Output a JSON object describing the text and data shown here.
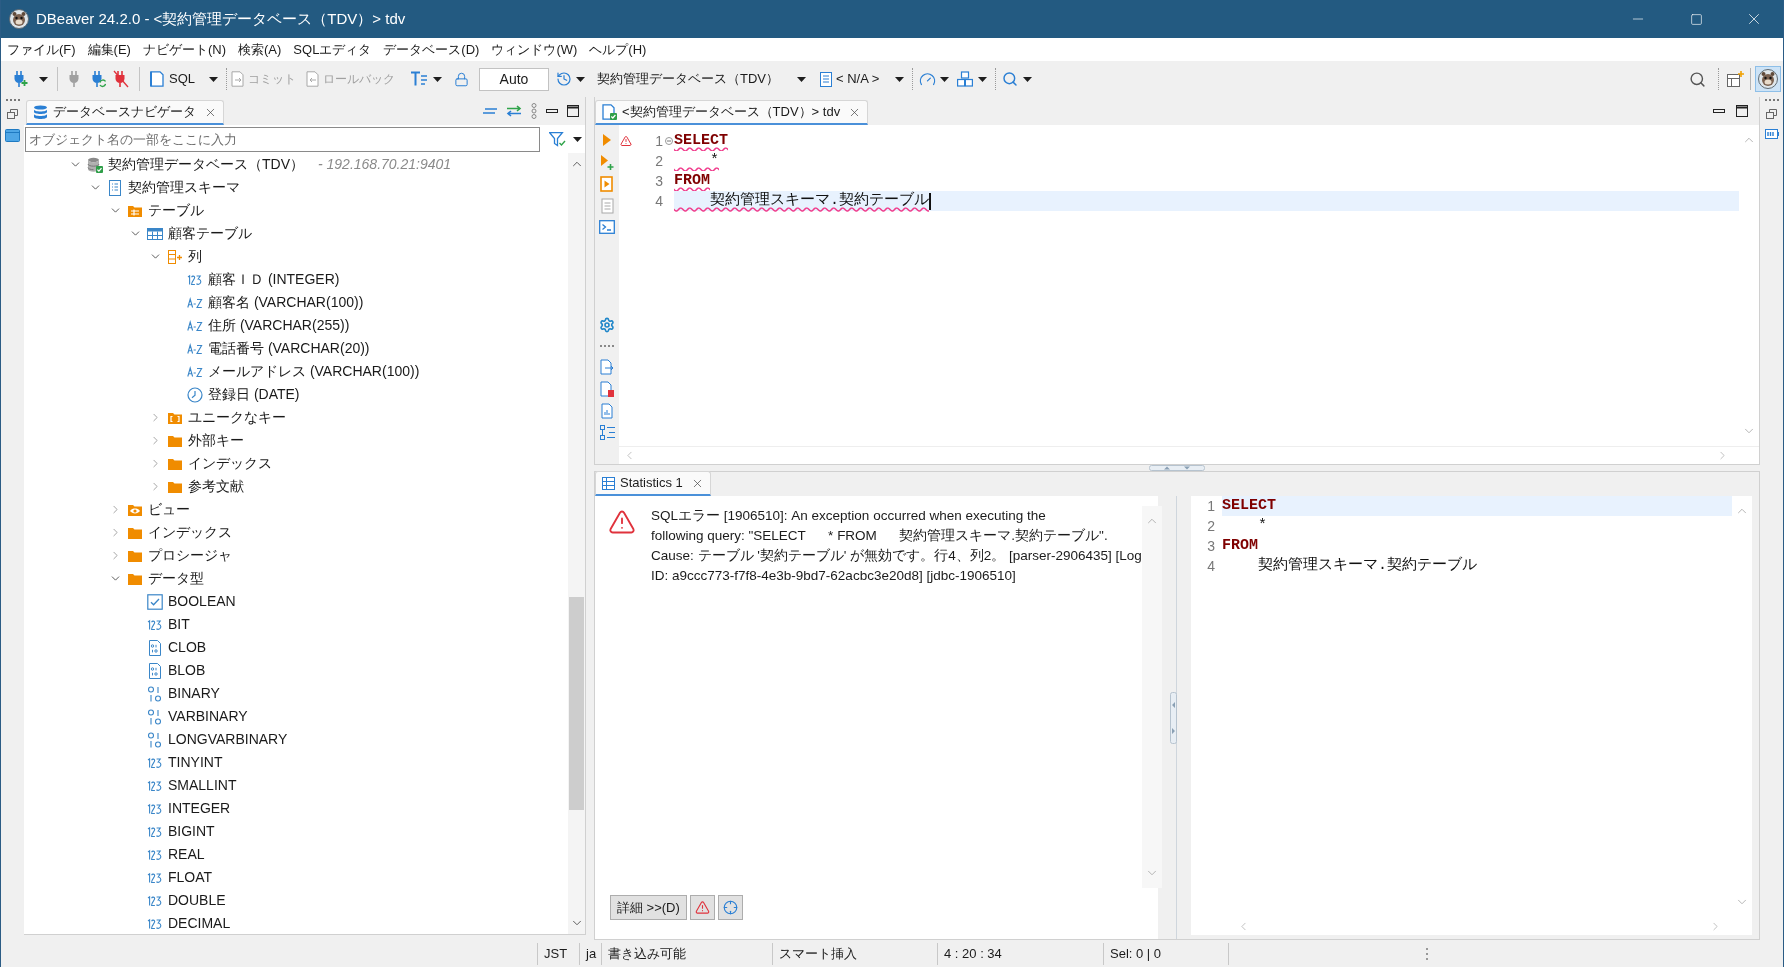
{
  "window": {
    "title": "DBeaver 24.2.0 - <契約管理データベース（TDV）> tdv"
  },
  "menu_bar": [
    "ファイル(F)",
    "編集(E)",
    "ナビゲート(N)",
    "検索(A)",
    "SQLエディタ",
    "データベース(D)",
    "ウィンドウ(W)",
    "ヘルプ(H)"
  ],
  "toolbar": {
    "sql_button": {
      "label": "SQL"
    },
    "commit_button": {
      "label": "コミット",
      "disabled": true
    },
    "rollback_button": {
      "label": "ロールバック",
      "disabled": true
    },
    "transaction_mode": {
      "value": "Auto"
    },
    "datasource_selector": {
      "value": "契約管理データベース（TDV）"
    },
    "schema_selector": {
      "value": "< N/A >"
    },
    "perspective_button": {
      "selected": true
    }
  },
  "navigator": {
    "tab": {
      "label": "データベースナビゲータ",
      "selected": true
    },
    "filter_field": {
      "placeholder": "オブジェクト名の一部をここに入力"
    },
    "tree": [
      {
        "label": "契約管理データベース（TDV）",
        "detail": "- 192.168.70.21:9401",
        "kind": "connection",
        "expanded": true,
        "children": [
          {
            "label": "契約管理スキーマ",
            "kind": "schema",
            "expanded": true,
            "children": [
              {
                "label": "テーブル",
                "kind": "tables",
                "expanded": true,
                "children": [
                  {
                    "label": "顧客テーブル",
                    "kind": "table",
                    "expanded": true,
                    "children": [
                      {
                        "label": "列",
                        "kind": "columns",
                        "expanded": true,
                        "children": [
                          {
                            "label": "顧客ＩＤ (INTEGER)",
                            "kind": "numeric"
                          },
                          {
                            "label": "顧客名 (VARCHAR(100))",
                            "kind": "text"
                          },
                          {
                            "label": "住所 (VARCHAR(255))",
                            "kind": "text"
                          },
                          {
                            "label": "電話番号 (VARCHAR(20))",
                            "kind": "text"
                          },
                          {
                            "label": "メールアドレス (VARCHAR(100))",
                            "kind": "text"
                          },
                          {
                            "label": "登録日 (DATE)",
                            "kind": "date"
                          }
                        ]
                      },
                      {
                        "label": "ユニークなキー",
                        "kind": "keys",
                        "expanded": false
                      },
                      {
                        "label": "外部キー",
                        "kind": "folder",
                        "expanded": false
                      },
                      {
                        "label": "インデックス",
                        "kind": "folder",
                        "expanded": false
                      },
                      {
                        "label": "参考文献",
                        "kind": "folder",
                        "expanded": false
                      }
                    ]
                  }
                ]
              },
              {
                "label": "ビュー",
                "kind": "views",
                "expanded": false
              },
              {
                "label": "インデックス",
                "kind": "folder",
                "expanded": false
              },
              {
                "label": "プロシージャ",
                "kind": "folder",
                "expanded": false
              },
              {
                "label": "データ型",
                "kind": "folder",
                "expanded": true,
                "children": [
                  {
                    "label": "BOOLEAN",
                    "kind": "boolean"
                  },
                  {
                    "label": "BIT",
                    "kind": "numeric"
                  },
                  {
                    "label": "CLOB",
                    "kind": "lob"
                  },
                  {
                    "label": "BLOB",
                    "kind": "lob"
                  },
                  {
                    "label": "BINARY",
                    "kind": "binary"
                  },
                  {
                    "label": "VARBINARY",
                    "kind": "binary"
                  },
                  {
                    "label": "LONGVARBINARY",
                    "kind": "binary"
                  },
                  {
                    "label": "TINYINT",
                    "kind": "numeric"
                  },
                  {
                    "label": "SMALLINT",
                    "kind": "numeric"
                  },
                  {
                    "label": "INTEGER",
                    "kind": "numeric"
                  },
                  {
                    "label": "BIGINT",
                    "kind": "numeric"
                  },
                  {
                    "label": "REAL",
                    "kind": "numeric"
                  },
                  {
                    "label": "FLOAT",
                    "kind": "numeric"
                  },
                  {
                    "label": "DOUBLE",
                    "kind": "numeric"
                  },
                  {
                    "label": "DECIMAL",
                    "kind": "numeric"
                  }
                ]
              }
            ]
          }
        ]
      }
    ]
  },
  "editor": {
    "tab": {
      "label": "<契約管理データベース（TDV）> tdv",
      "selected": true
    },
    "lines": [
      {
        "number": "1",
        "text": "SELECT",
        "kind": "keyword",
        "error": true,
        "current": false,
        "caret": false,
        "warning": true,
        "foldable": true
      },
      {
        "number": "2",
        "text": "    *",
        "kind": "plain",
        "error": true,
        "current": false,
        "caret": false,
        "warning": false,
        "foldable": false
      },
      {
        "number": "3",
        "text": "FROM",
        "kind": "keyword",
        "error": true,
        "current": false,
        "caret": false,
        "warning": false,
        "foldable": false
      },
      {
        "number": "4",
        "text": "    契約管理スキーマ.契約テーブル",
        "kind": "plain",
        "error": true,
        "current": true,
        "caret": true,
        "warning": false,
        "foldable": false
      }
    ]
  },
  "results": {
    "tab": {
      "label": "Statistics 1",
      "selected": true
    },
    "error_message": [
      "SQLエラー [1906510]: An exception occurred when executing the",
      "following query: \"SELECT      * FROM      契約管理スキーマ.契約テーブル\".",
      "Cause: テーブル '契約テーブル' が無効です。行4、列2。 [parser-2906435] [Log",
      "ID: a9ccc773-f7f8-4e3b-9bd7-62acbc3e20d8] [jdbc-1906510]"
    ],
    "details_button": {
      "label": "詳細 >>(D)"
    },
    "query_lines": [
      {
        "number": "1",
        "text": "SELECT",
        "kind": "keyword",
        "current": true
      },
      {
        "number": "2",
        "text": "    *",
        "kind": "plain",
        "current": false
      },
      {
        "number": "3",
        "text": "FROM",
        "kind": "keyword",
        "current": false
      },
      {
        "number": "4",
        "text": "    契約管理スキーマ.契約テーブル",
        "kind": "plain",
        "current": false
      }
    ]
  },
  "status_bar": [
    "JST",
    "ja",
    "書き込み可能",
    "スマート挿入",
    "4 : 20 : 34",
    "Sel: 0 | 0"
  ]
}
